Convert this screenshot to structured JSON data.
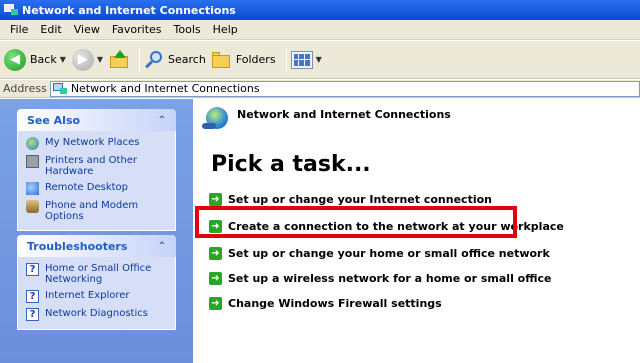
{
  "window": {
    "title": "Network and Internet Connections"
  },
  "menu": [
    "File",
    "Edit",
    "View",
    "Favorites",
    "Tools",
    "Help"
  ],
  "toolbar": {
    "back_label": "Back",
    "search_label": "Search",
    "folders_label": "Folders"
  },
  "address": {
    "label": "Address",
    "value": "Network and Internet Connections"
  },
  "see_also": {
    "title": "See Also",
    "items": [
      {
        "label": "My Network Places",
        "icon": "network-places-icon"
      },
      {
        "label": "Printers and Other Hardware",
        "icon": "printer-icon"
      },
      {
        "label": "Remote Desktop",
        "icon": "remote-desktop-icon"
      },
      {
        "label": "Phone and Modem Options",
        "icon": "phone-icon"
      }
    ]
  },
  "troubleshooters": {
    "title": "Troubleshooters",
    "items": [
      {
        "label": "Home or Small Office Networking",
        "icon": "help-icon"
      },
      {
        "label": "Internet Explorer",
        "icon": "help-icon"
      },
      {
        "label": "Network Diagnostics",
        "icon": "help-icon"
      }
    ]
  },
  "main": {
    "category_title": "Network and Internet Connections",
    "heading": "Pick a task...",
    "tasks": [
      "Set up or change your Internet connection",
      "Create a connection to the network at your workplace",
      "Set up or change your home or small office network",
      "Set up a wireless network for a home or small office",
      "Change Windows Firewall settings"
    ]
  },
  "colors": {
    "highlight": "#e3000f",
    "task_arrow": "#2aa52a",
    "link": "#0c3a9c"
  }
}
